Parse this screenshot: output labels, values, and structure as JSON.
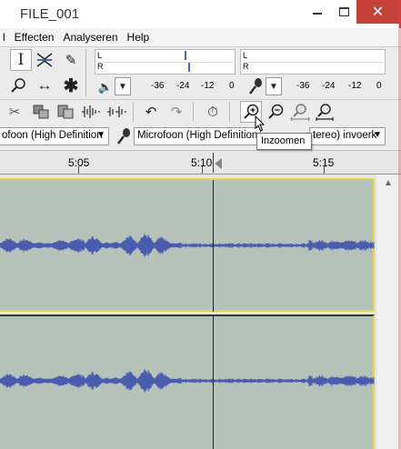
{
  "window": {
    "title": "FILE_001"
  },
  "menu": {
    "items": [
      "Effecten",
      "Analyseren",
      "Help"
    ]
  },
  "meters": {
    "left_channel": "L",
    "right_channel": "R",
    "playback_scale": [
      "-36",
      "-24",
      "-12",
      "0"
    ],
    "record_scale": [
      "-36",
      "-24",
      "-12",
      "0"
    ]
  },
  "devices": {
    "playback": "Microfoon (High Definition A",
    "playback_partial": "ofoon (High Definition",
    "channels_partial": "tereo) invoerk"
  },
  "tooltip": {
    "text": "Inzoomen"
  },
  "ruler": {
    "labels": [
      "5:05",
      "5:10",
      "5:15"
    ]
  },
  "colors": {
    "track_bg": "#b5c2ba",
    "waveform": "#4a5cae",
    "selection_border": "#e4d84a",
    "close_button": "#c7413b"
  }
}
